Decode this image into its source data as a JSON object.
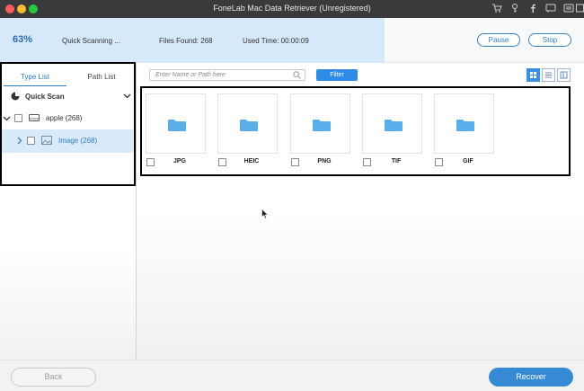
{
  "window": {
    "title": "FoneLab Mac Data Retriever (Unregistered)",
    "toolbar_icons": [
      "cart-icon",
      "key-icon",
      "facebook-icon",
      "chat-icon",
      "menu-icon",
      "save-icon"
    ]
  },
  "scan": {
    "percent": "63%",
    "progress": 0.63,
    "status": "Quick Scanning ...",
    "files_found": "Files Found: 268",
    "used_time": "Used Time: 00:00:09",
    "pause_label": "Pause",
    "stop_label": "Stop"
  },
  "sidebar": {
    "tabs": [
      {
        "label": "Type List",
        "active": true
      },
      {
        "label": "Path List",
        "active": false
      }
    ],
    "quick_scan_label": "Quick Scan",
    "tree": [
      {
        "label": "apple (268)",
        "icon": "drive-icon"
      },
      {
        "label": "Image (268)",
        "icon": "image-icon",
        "selected": true
      }
    ]
  },
  "search": {
    "placeholder": "Enter Name or Path here"
  },
  "filter_label": "Filter",
  "view_modes": [
    "grid-view",
    "list-view",
    "column-view"
  ],
  "file_types": [
    {
      "label": "JPG"
    },
    {
      "label": "HEIC"
    },
    {
      "label": "PNG"
    },
    {
      "label": "TIF"
    },
    {
      "label": "GIF"
    }
  ],
  "footer": {
    "back_label": "Back",
    "recover_label": "Recover"
  },
  "colors": {
    "accent": "#2f8be6",
    "progress": "#d6e9fb",
    "folder": "#5aaeea"
  }
}
